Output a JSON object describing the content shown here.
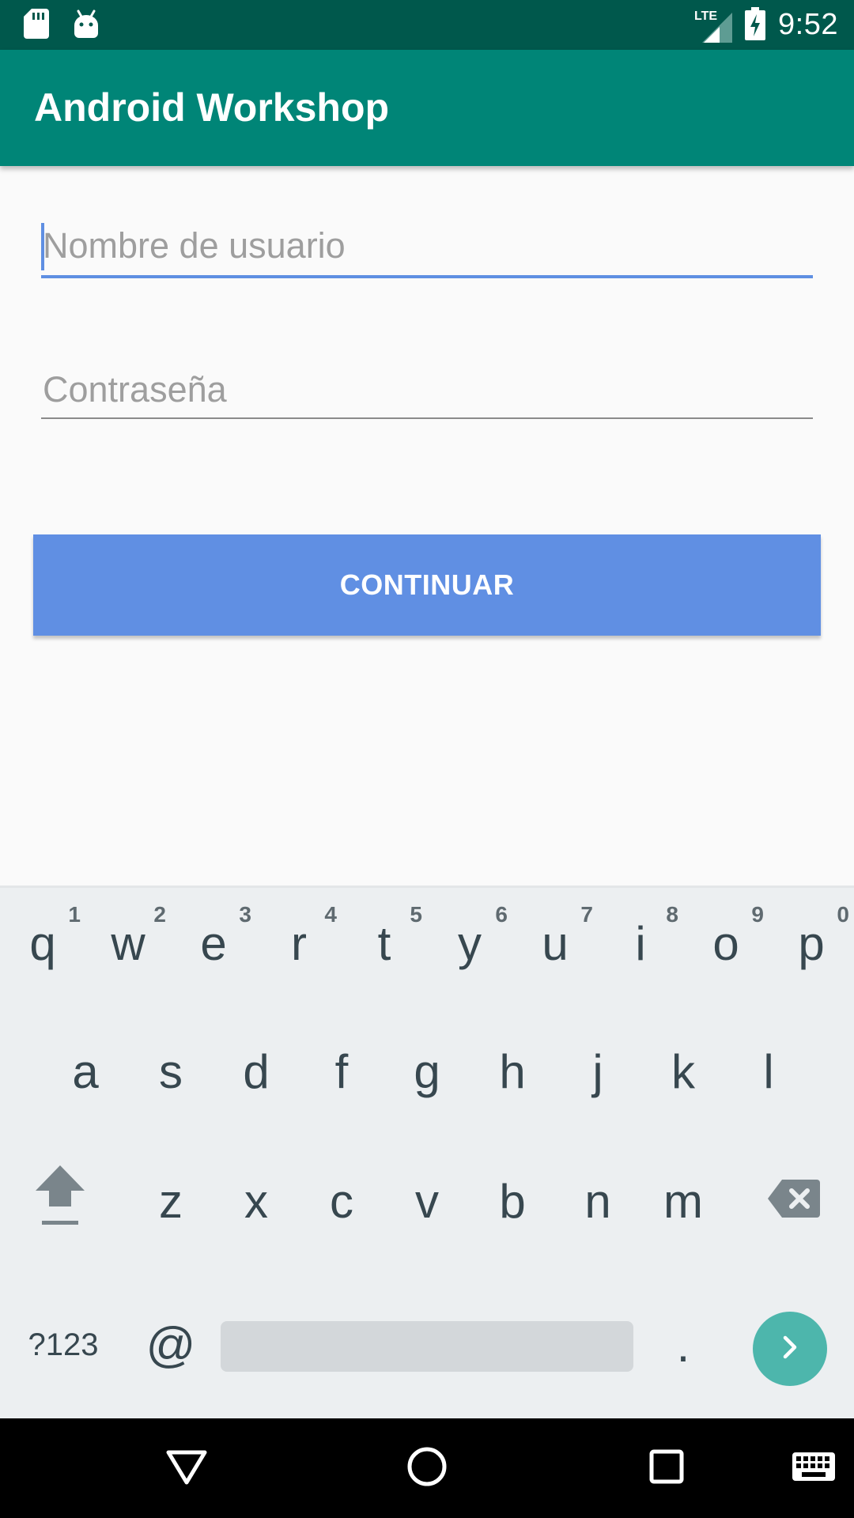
{
  "status_bar": {
    "time": "9:52",
    "network_label": "LTE",
    "left_icons": [
      "sd-card-icon",
      "android-icon"
    ],
    "right_icons": [
      "lte-signal-icon",
      "battery-charging-icon"
    ]
  },
  "app_bar": {
    "title": "Android Workshop",
    "color": "#008577"
  },
  "form": {
    "username": {
      "placeholder": "Nombre de usuario",
      "value": "",
      "focused": true
    },
    "password": {
      "placeholder": "Contraseña",
      "value": ""
    },
    "continue_label": "CONTINUAR",
    "accent_color": "#608FE3"
  },
  "keyboard": {
    "row1": [
      {
        "k": "q",
        "h": "1"
      },
      {
        "k": "w",
        "h": "2"
      },
      {
        "k": "e",
        "h": "3"
      },
      {
        "k": "r",
        "h": "4"
      },
      {
        "k": "t",
        "h": "5"
      },
      {
        "k": "y",
        "h": "6"
      },
      {
        "k": "u",
        "h": "7"
      },
      {
        "k": "i",
        "h": "8"
      },
      {
        "k": "o",
        "h": "9"
      },
      {
        "k": "p",
        "h": "0"
      }
    ],
    "row2": [
      "a",
      "s",
      "d",
      "f",
      "g",
      "h",
      "j",
      "k",
      "l"
    ],
    "row3": [
      "z",
      "x",
      "c",
      "v",
      "b",
      "n",
      "m"
    ],
    "symbols_label": "?123",
    "at_label": "@",
    "period_label": ".",
    "shift_icon": "shift-arrow-icon",
    "backspace_icon": "backspace-icon",
    "enter_icon": "chevron-right-icon",
    "enter_color": "#4DB6AC"
  },
  "nav_bar": {
    "icons": [
      "back-triangle-icon",
      "home-circle-icon",
      "recents-square-icon",
      "keyboard-switch-icon"
    ]
  }
}
